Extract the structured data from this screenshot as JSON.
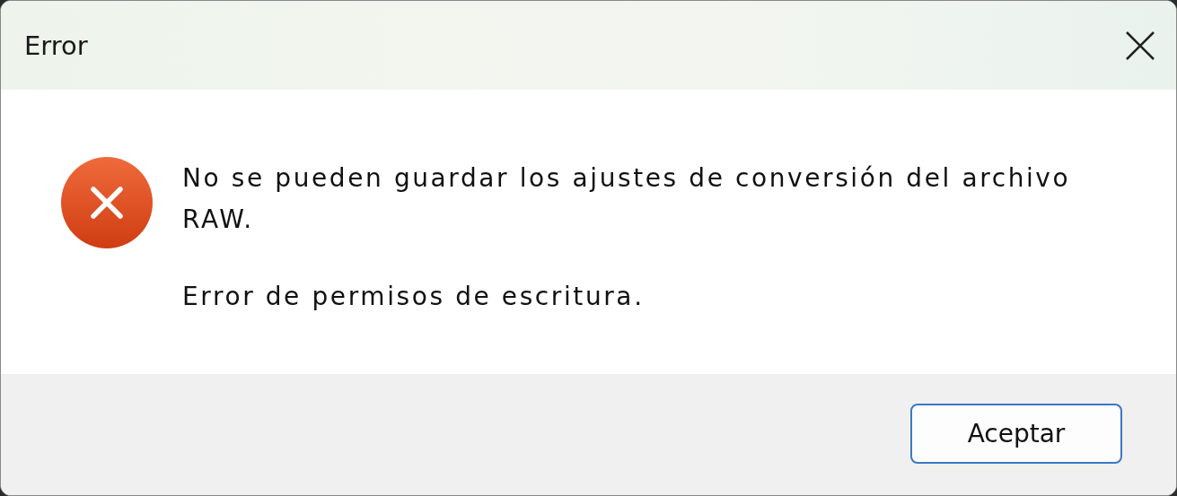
{
  "window": {
    "title": "Error"
  },
  "message": {
    "kind": "error",
    "paragraphs": [
      "No se pueden guardar los ajustes de conversión del archivo RAW.",
      "Error de permisos de escritura."
    ]
  },
  "buttons": [
    {
      "label": "Aceptar",
      "default": true
    }
  ]
}
